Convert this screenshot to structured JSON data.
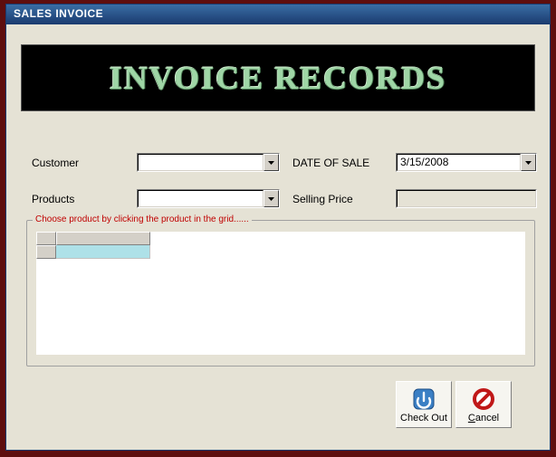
{
  "window": {
    "title": "SALES INVOICE"
  },
  "banner": {
    "text": "INVOICE RECORDS"
  },
  "form": {
    "customer_label": "Customer",
    "customer_value": "",
    "date_label": "DATE OF SALE",
    "date_value": "3/15/2008",
    "products_label": "Products",
    "products_value": "",
    "price_label": "Selling Price",
    "price_value": ""
  },
  "grid": {
    "legend": "Choose product by clicking the product in the grid......"
  },
  "buttons": {
    "checkout": "Check Out",
    "cancel_prefix": "C",
    "cancel_rest": "ancel"
  }
}
